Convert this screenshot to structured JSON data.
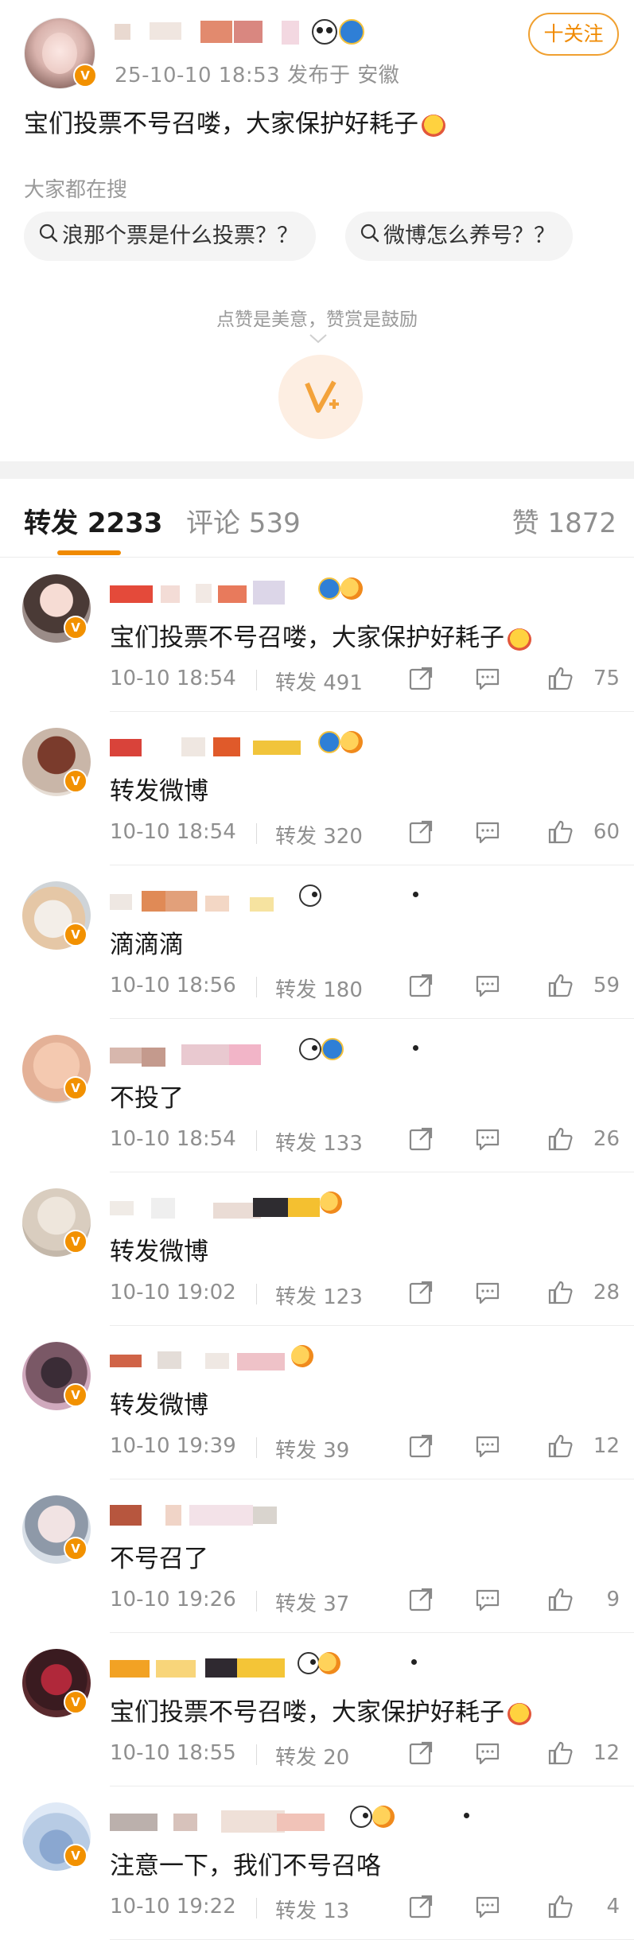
{
  "post": {
    "time_location": "25-10-10 18:53  发布于 安徽",
    "follow_label": "十关注",
    "text": "宝们投票不号召喽，大家保护好耗子",
    "search_label": "大家都在搜",
    "search_chips": [
      "浪那个票是什么投票？？",
      "微博怎么养号？？"
    ],
    "reward_text": "点赞是美意，赞赏是鼓励"
  },
  "tabs": {
    "repost": "转发 2233",
    "comment": "评论 539",
    "like": "赞 1872"
  },
  "colors": {
    "accent": "#f08a00",
    "vip_badge": "#f29100",
    "muted": "#8f8f8f"
  },
  "reposts": [
    {
      "text": "宝们投票不号召喽，大家保护好耗子",
      "time": "10-10 18:54",
      "repost": "转发 491",
      "likes": "75"
    },
    {
      "text": "转发微博",
      "time": "10-10 18:54",
      "repost": "转发 320",
      "likes": "60"
    },
    {
      "text": "滴滴滴",
      "time": "10-10 18:56",
      "repost": "转发 180",
      "likes": "59"
    },
    {
      "text": "不投了",
      "time": "10-10 18:54",
      "repost": "转发 133",
      "likes": "26"
    },
    {
      "text": "转发微博",
      "time": "10-10 19:02",
      "repost": "转发 123",
      "likes": "28"
    },
    {
      "text": "转发微博",
      "time": "10-10 19:39",
      "repost": "转发 39",
      "likes": "12"
    },
    {
      "text": "不号召了",
      "time": "10-10 19:26",
      "repost": "转发 37",
      "likes": "9"
    },
    {
      "text": "宝们投票不号召喽，大家保护好耗子",
      "time": "10-10 18:55",
      "repost": "转发 20",
      "likes": "12"
    },
    {
      "text": "注意一下，我们不号召咯",
      "time": "10-10 19:22",
      "repost": "转发 13",
      "likes": "4"
    }
  ]
}
